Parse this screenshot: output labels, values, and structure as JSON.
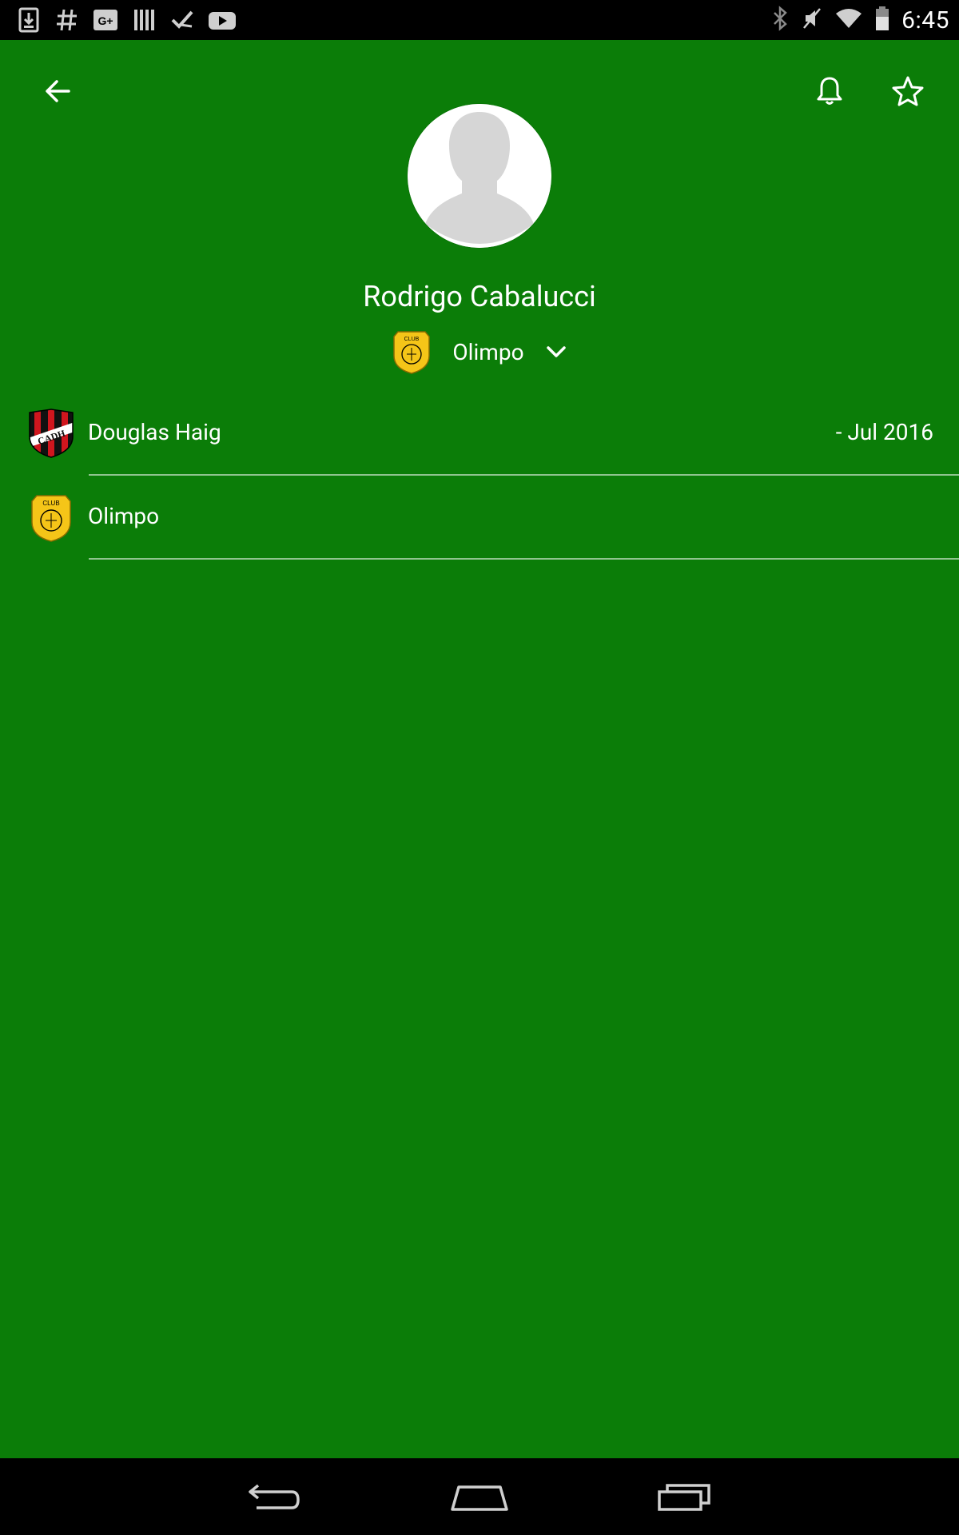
{
  "status_bar": {
    "time": "6:45",
    "notification_icons": [
      "download-icon",
      "hashtag-icon",
      "google-plus-icon",
      "library-icon",
      "tasks-icon",
      "youtube-icon"
    ],
    "system_icons": [
      "bluetooth-icon",
      "mute-icon",
      "wifi-icon",
      "battery-icon"
    ]
  },
  "app_bar": {
    "back_icon": "arrow-back-icon",
    "bell_icon": "bell-icon",
    "star_icon": "star-outline-icon"
  },
  "player": {
    "name": "Rodrigo Cabalucci",
    "current_team": "Olimpo"
  },
  "career": [
    {
      "club": "Douglas Haig",
      "crest_text": "CADH",
      "period": "- Jul 2016"
    },
    {
      "club": "Olimpo",
      "crest_text": "CLUB",
      "period": ""
    }
  ],
  "colors": {
    "background": "#0b7d08",
    "system_bars": "#000000",
    "olimpo_crest": "#f5c518",
    "douglas_haig_red": "#d0161e",
    "douglas_haig_black": "#111111"
  },
  "nav_bar": {
    "buttons": [
      "back-icon",
      "home-icon",
      "recent-apps-icon"
    ]
  }
}
